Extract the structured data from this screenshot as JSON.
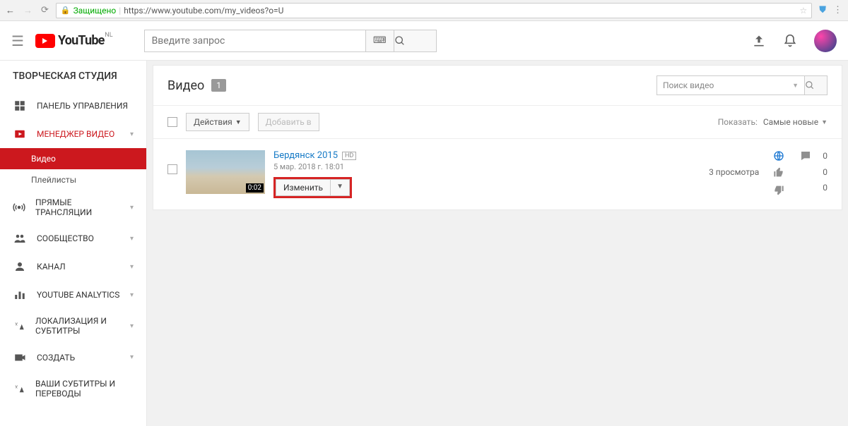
{
  "browser": {
    "secure_label": "Защищено",
    "url": "https://www.youtube.com/my_videos?o=U"
  },
  "header": {
    "logo_text": "YouTube",
    "country": "NL",
    "search_placeholder": "Введите запрос"
  },
  "sidebar": {
    "title": "ТВОРЧЕСКАЯ СТУДИЯ",
    "items": [
      {
        "label": "ПАНЕЛЬ УПРАВЛЕНИЯ"
      },
      {
        "label": "МЕНЕДЖЕР ВИДЕО"
      },
      {
        "label": "ПРЯМЫЕ ТРАНСЛЯЦИИ"
      },
      {
        "label": "СООБЩЕСТВО"
      },
      {
        "label": "КАНАЛ"
      },
      {
        "label": "YOUTUBE ANALYTICS"
      },
      {
        "label": "ЛОКАЛИЗАЦИЯ И СУБТИТРЫ"
      },
      {
        "label": "СОЗДАТЬ"
      },
      {
        "label": "ВАШИ СУБТИТРЫ И ПЕРЕВОДЫ"
      }
    ],
    "sub": {
      "videos": "Видео",
      "playlists": "Плейлисты"
    }
  },
  "main": {
    "heading": "Видео",
    "count": "1",
    "search_placeholder": "Поиск видео",
    "toolbar": {
      "actions": "Действия",
      "add_to": "Добавить в",
      "show_label": "Показать:",
      "sort": "Самые новые"
    },
    "video": {
      "title": "Бердянск 2015",
      "quality": "HD",
      "date": "5 мар. 2018 г. 18:01",
      "duration": "0:02",
      "edit": "Изменить",
      "views": "3 просмотра",
      "comments": "0",
      "likes": "0",
      "dislikes": "0"
    }
  }
}
